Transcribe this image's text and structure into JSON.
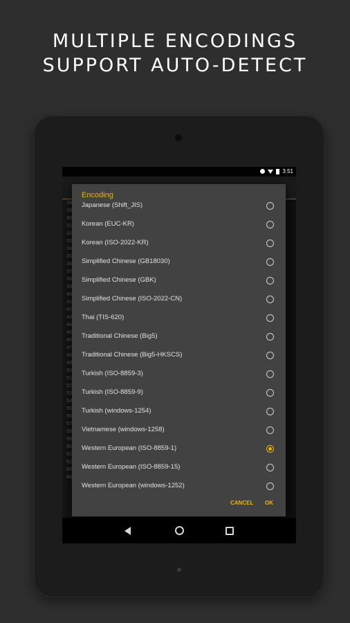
{
  "promo": {
    "line1": "MULTIPLE ENCODINGS",
    "line2": "SUPPORT AUTO-DETECT"
  },
  "statusbar": {
    "time": "3:51"
  },
  "app": {
    "title": "Encoding"
  },
  "gutter_lines": [
    "28",
    "29",
    "30",
    "31",
    "32",
    "33",
    "34",
    "35",
    "36",
    "37",
    "38",
    "39",
    "40",
    "41",
    "42",
    "43",
    "44",
    "45",
    "46",
    "47",
    "48",
    "49",
    "50",
    "51",
    "52",
    "53",
    "54",
    "55",
    "56",
    "57",
    "58",
    "59",
    "60",
    "61",
    "62",
    "63",
    "64"
  ],
  "dialog": {
    "title": "Encoding",
    "options": [
      {
        "label": "Japanese (Shift_JIS)",
        "selected": false
      },
      {
        "label": "Korean (EUC-KR)",
        "selected": false
      },
      {
        "label": "Korean (ISO-2022-KR)",
        "selected": false
      },
      {
        "label": "Simplified Chinese (GB18030)",
        "selected": false
      },
      {
        "label": "Simplified Chinese (GBK)",
        "selected": false
      },
      {
        "label": "Simplified Chinese (ISO-2022-CN)",
        "selected": false
      },
      {
        "label": "Thai (TIS-620)",
        "selected": false
      },
      {
        "label": "Traditional Chinese (Big5)",
        "selected": false
      },
      {
        "label": "Traditional Chinese (Big5-HKSCS)",
        "selected": false
      },
      {
        "label": "Turkish (ISO-8859-3)",
        "selected": false
      },
      {
        "label": "Turkish (ISO-8859-9)",
        "selected": false
      },
      {
        "label": "Turkish (windows-1254)",
        "selected": false
      },
      {
        "label": "Vietnamese (windows-1258)",
        "selected": false
      },
      {
        "label": "Western European (ISO-8859-1)",
        "selected": true
      },
      {
        "label": "Western European (ISO-8859-15)",
        "selected": false
      },
      {
        "label": "Western European (windows-1252)",
        "selected": false
      }
    ],
    "cancel_label": "CANCEL",
    "ok_label": "OK"
  },
  "icons": {
    "nav_back": "back-triangle-icon",
    "nav_home": "home-circle-icon",
    "nav_recent": "recent-square-icon"
  },
  "colors": {
    "accent": "#f0b400",
    "dialog_bg": "#424242",
    "page_bg": "#2e2e2e"
  }
}
